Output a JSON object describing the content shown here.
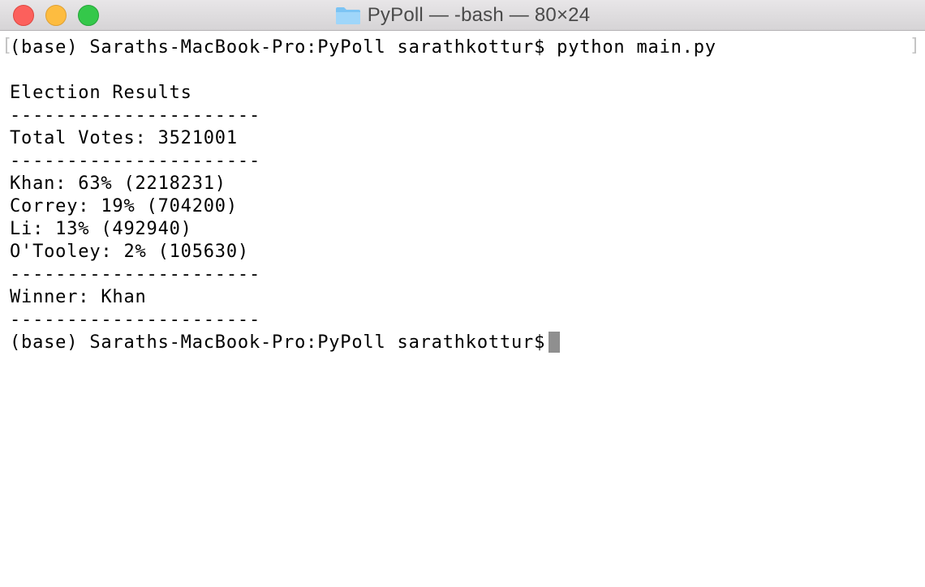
{
  "window": {
    "title": "PyPoll — -bash — 80×24",
    "icon": "folder-icon"
  },
  "terminal": {
    "lines": [
      "(base) Saraths-MacBook-Pro:PyPoll sarathkottur$ python main.py",
      "",
      "Election Results",
      "----------------------",
      "Total Votes: 3521001",
      "----------------------",
      "Khan: 63% (2218231)",
      "Correy: 19% (704200)",
      "Li: 13% (492940)",
      "O'Tooley: 2% (105630)",
      "----------------------",
      "Winner: Khan",
      "----------------------"
    ],
    "prompt": "(base) Saraths-MacBook-Pro:PyPoll sarathkottur$"
  },
  "colors": {
    "close": "#fc605c",
    "minimize": "#fdbc40",
    "maximize": "#34c84a",
    "cursor": "#8f8f8f",
    "folder": "#7cc4f4"
  }
}
